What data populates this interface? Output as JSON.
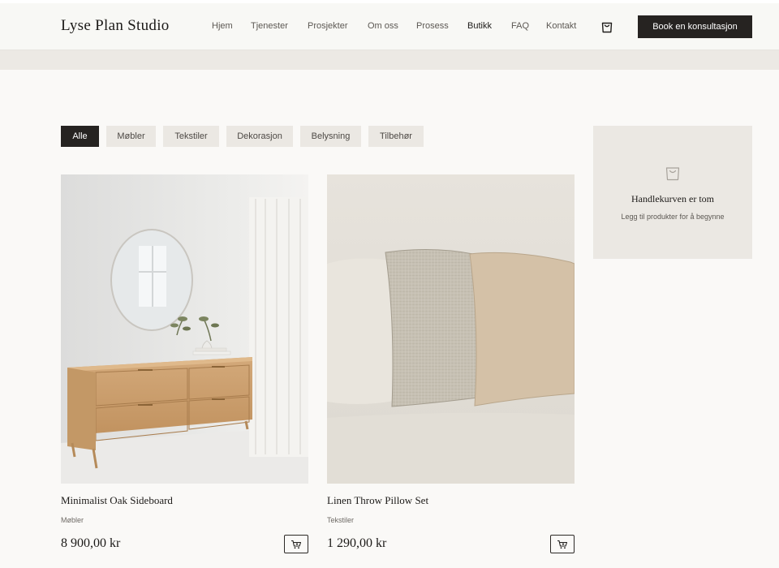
{
  "brand": {
    "name": "Lyse Plan Studio"
  },
  "nav": {
    "items": [
      {
        "label": "Hjem"
      },
      {
        "label": "Tjenester"
      },
      {
        "label": "Prosjekter"
      },
      {
        "label": "Om oss"
      },
      {
        "label": "Prosess"
      },
      {
        "label": "Butikk",
        "active": true
      },
      {
        "label": "FAQ"
      },
      {
        "label": "Kontakt"
      }
    ],
    "cart_icon": "shopping-bag-icon",
    "cta_label": "Book en konsultasjon"
  },
  "filters": {
    "items": [
      {
        "label": "Alle",
        "active": true
      },
      {
        "label": "Møbler"
      },
      {
        "label": "Tekstiler"
      },
      {
        "label": "Dekorasjon"
      },
      {
        "label": "Belysning"
      },
      {
        "label": "Tilbehør"
      }
    ]
  },
  "products": [
    {
      "name": "Minimalist Oak Sideboard",
      "category": "Møbler",
      "price": "8 900,00 kr",
      "add_icon": "cart-plus-icon"
    },
    {
      "name": "Linen Throw Pillow Set",
      "category": "Tekstiler",
      "price": "1 290,00 kr",
      "add_icon": "cart-plus-icon"
    }
  ],
  "cart": {
    "icon": "shopping-bag-icon",
    "empty_title": "Handlekurven er tom",
    "empty_subtitle": "Legg til produkter for å begynne"
  },
  "colors": {
    "page_bg": "#faf9f7",
    "accent_dark": "#262321",
    "chip_bg": "#ebe8e3",
    "band": "#ece9e4"
  }
}
